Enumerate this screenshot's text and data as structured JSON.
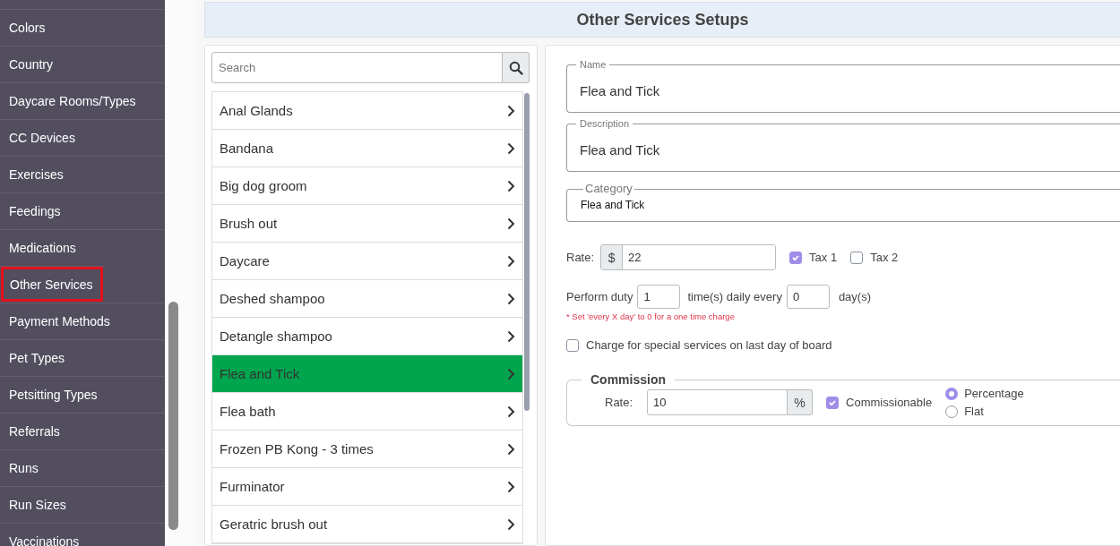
{
  "sidebar": {
    "items": [
      {
        "label": "Colors",
        "selected": false
      },
      {
        "label": "Country",
        "selected": false
      },
      {
        "label": "Daycare Rooms/Types",
        "selected": false
      },
      {
        "label": "CC Devices",
        "selected": false
      },
      {
        "label": "Exercises",
        "selected": false
      },
      {
        "label": "Feedings",
        "selected": false
      },
      {
        "label": "Medications",
        "selected": false
      },
      {
        "label": "Other Services",
        "selected": true
      },
      {
        "label": "Payment Methods",
        "selected": false
      },
      {
        "label": "Pet Types",
        "selected": false
      },
      {
        "label": "Petsitting Types",
        "selected": false
      },
      {
        "label": "Referrals",
        "selected": false
      },
      {
        "label": "Runs",
        "selected": false
      },
      {
        "label": "Run Sizes",
        "selected": false
      },
      {
        "label": "Vaccinations",
        "selected": false
      }
    ]
  },
  "title": "Other Services Setups",
  "search": {
    "placeholder": "Search"
  },
  "services": [
    {
      "label": "Anal Glands",
      "selected": false
    },
    {
      "label": "Bandana",
      "selected": false
    },
    {
      "label": "Big dog groom",
      "selected": false
    },
    {
      "label": "Brush out",
      "selected": false
    },
    {
      "label": "Daycare",
      "selected": false
    },
    {
      "label": "Deshed shampoo",
      "selected": false
    },
    {
      "label": "Detangle shampoo",
      "selected": false
    },
    {
      "label": "Flea and Tick",
      "selected": true
    },
    {
      "label": "Flea bath",
      "selected": false
    },
    {
      "label": "Frozen PB Kong - 3 times",
      "selected": false
    },
    {
      "label": "Furminator",
      "selected": false
    },
    {
      "label": "Geratric brush out",
      "selected": false
    }
  ],
  "form": {
    "name": {
      "label": "Name",
      "value": "Flea and Tick"
    },
    "description": {
      "label": "Description",
      "value": "Flea and Tick"
    },
    "category": {
      "label": "Category",
      "value": "Flea and Tick"
    },
    "rate": {
      "label": "Rate:",
      "prefix": "$",
      "value": "22"
    },
    "taxes": [
      {
        "label": "Tax 1",
        "checked": true
      },
      {
        "label": "Tax 2",
        "checked": false
      }
    ],
    "perform": {
      "label": "Perform duty",
      "times": "1",
      "middle": "time(s) daily every",
      "every": "0",
      "suffix": "day(s)"
    },
    "note": "* Set 'every X day' to 0 for a one time charge",
    "special": {
      "label": "Charge for special services on last day of board",
      "checked": false
    },
    "commission": {
      "title": "Commission",
      "rate_label": "Rate:",
      "value": "10",
      "suffix": "%",
      "commissionable": {
        "label": "Commissionable",
        "checked": true
      },
      "types": [
        {
          "label": "Percentage",
          "selected": true
        },
        {
          "label": "Flat",
          "selected": false
        }
      ]
    }
  }
}
